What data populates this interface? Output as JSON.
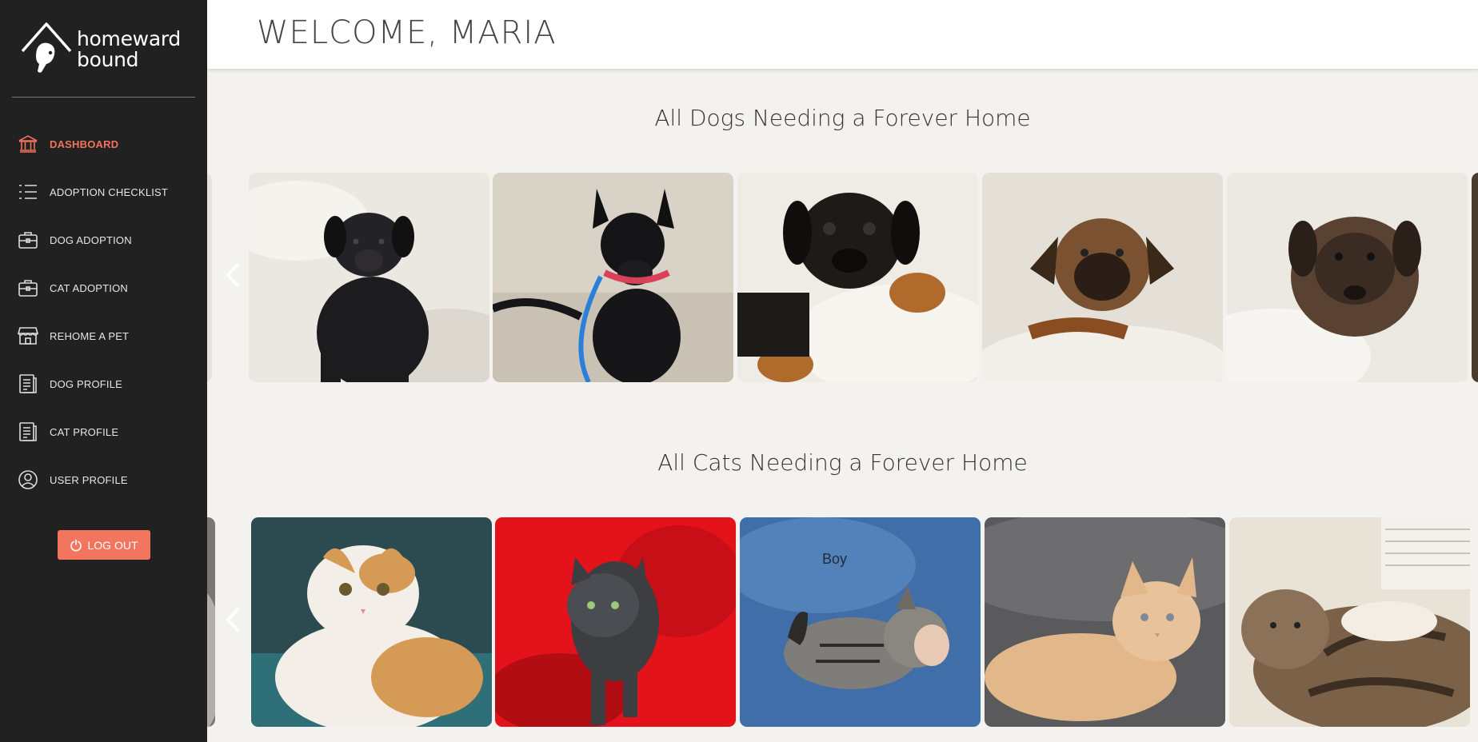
{
  "app": {
    "logo_line1": "homeward",
    "logo_line2": "bound"
  },
  "sidebar": {
    "items": [
      {
        "label": "DASHBOARD",
        "icon": "bank-icon",
        "active": true
      },
      {
        "label": "ADOPTION CHECKLIST",
        "icon": "list-icon"
      },
      {
        "label": "DOG ADOPTION",
        "icon": "briefcase-icon"
      },
      {
        "label": "CAT ADOPTION",
        "icon": "briefcase-icon"
      },
      {
        "label": "REHOME A PET",
        "icon": "store-icon"
      },
      {
        "label": "DOG PROFILE",
        "icon": "document-icon"
      },
      {
        "label": "CAT PROFILE",
        "icon": "document-icon"
      },
      {
        "label": "USER PROFILE",
        "icon": "user-circle-icon"
      }
    ],
    "logout_label": "LOG OUT"
  },
  "header": {
    "welcome": "WELCOME, MARIA"
  },
  "dogs": {
    "title": "All Dogs Needing a Forever Home",
    "photos": [
      "black-puppy-photo",
      "black-dog-blue-leash-photo",
      "black-tan-puppy-photo",
      "brown-puppy-photo",
      "fluffy-puppy-photo"
    ]
  },
  "cats": {
    "title": "All Cats Needing a Forever Home",
    "photos": [
      "orange-white-cat-photo",
      "gray-cat-red-blanket-photo",
      "tabby-kitten-photo",
      "orange-kitten-photo",
      "tabby-cat-photo"
    ],
    "kitten_label": "Boy"
  },
  "colors": {
    "sidebar_bg": "#212121",
    "accent": "#f0735a",
    "logout_bg": "#f3755e",
    "page_bg": "#f3f2ef"
  }
}
